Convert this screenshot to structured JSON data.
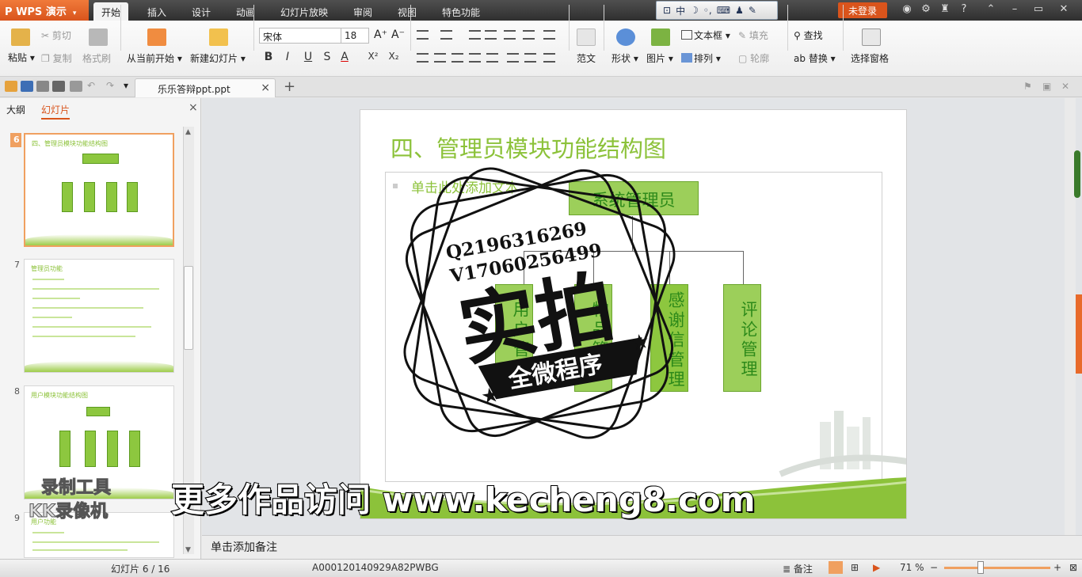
{
  "app": {
    "name": "WPS 演示",
    "drop": "▾"
  },
  "menu": [
    "开始",
    "插入",
    "设计",
    "动画",
    "幻灯片放映",
    "审阅",
    "视图",
    "特色功能"
  ],
  "ime": {
    "lang": "中"
  },
  "titlebar": {
    "login": "未登录",
    "help": "?"
  },
  "ribbon": {
    "paste": "粘贴",
    "cut": "剪切",
    "copy": "复制",
    "format_painter": "格式刷",
    "from_current": "从当前开始",
    "new_slide": "新建幻灯片",
    "font_name": "宋体",
    "font_size": "18",
    "fmt": [
      "B",
      "I",
      "U",
      "S",
      "A",
      "X²",
      "X₂"
    ],
    "template": "范文",
    "shape": "形状",
    "picture": "图片",
    "textbox": "文本框",
    "arrange": "排列",
    "fill": "填充",
    "outline": "轮廓",
    "find": "查找",
    "replace": "替换",
    "select_pane": "选择窗格"
  },
  "document": {
    "tab_name": "乐乐答辩ppt.ppt",
    "close": "×",
    "add": "+"
  },
  "left_pane": {
    "outline_tab": "大纲",
    "slides_tab": "幻灯片",
    "close": "×"
  },
  "thumbnails": [
    {
      "num": "6",
      "title": "四、管理员模块功能结构图"
    },
    {
      "num": "7",
      "title": "管理员功能"
    },
    {
      "num": "8",
      "title": "用户模块功能结构图"
    },
    {
      "num": "9",
      "title": "用户功能"
    }
  ],
  "slide": {
    "title": "四、管理员模块功能结构图",
    "placeholder": "单击此处添加文本",
    "root": "系统管理员",
    "children": [
      "用户管理",
      "物品管理",
      "感谢信管理",
      "评论管理"
    ]
  },
  "notes": {
    "placeholder": "单击添加备注"
  },
  "status": {
    "slide_counter": "幻灯片 6 / 16",
    "doc_id": "A000120140929A82PWBG",
    "notes": "备注",
    "zoom": "71 %",
    "zoom_level": 0.71
  },
  "overlay": {
    "stamp_line1": "Q2196316269",
    "stamp_line2": "V17060256499",
    "stamp_big": "实拍",
    "stamp_banner": "全微程序",
    "watermark_main": "更多作品访问 www.kecheng8.com",
    "watermark_tool1": "录制工具",
    "watermark_tool2": "KK录像机"
  },
  "colors": {
    "accent": "#d9541c",
    "green": "#8cc23a",
    "box": "#9ccf5a"
  }
}
